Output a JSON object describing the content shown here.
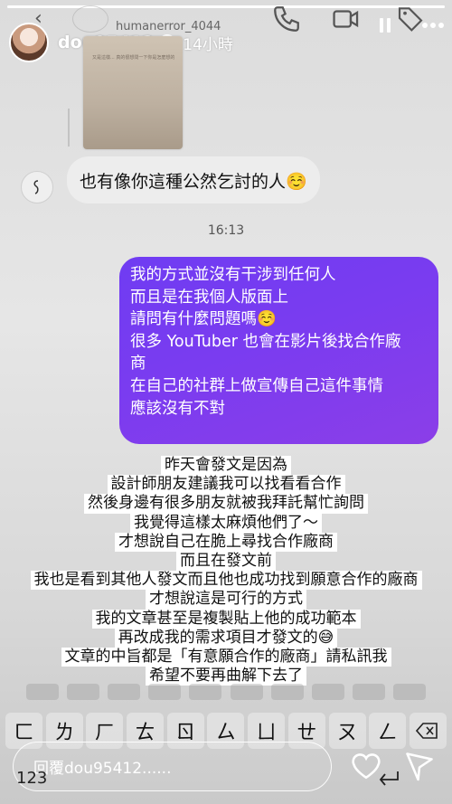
{
  "story": {
    "username": "dou95412",
    "time_ago": "14小時",
    "progress": 1.0
  },
  "background_chat": {
    "other_username": "humanerror_4044",
    "shared_image_text": "又是這樣... 真的很想問一下你是怎麼想的",
    "incoming_message": "也有像你這種公然乞討的人☺️",
    "timestamp": "16:13",
    "outgoing_lines": [
      "我的方式並沒有干涉到任何人",
      "而且是在我個人版面上",
      "請問有什麼問題嗎☺️",
      "很多 YouTuber 也會在影片後找合作廠",
      "商",
      "在自己的社群上做宣傳自己這件事情",
      "應該沒有不對"
    ]
  },
  "overlay_lines": [
    "昨天會發文是因為",
    "設計師朋友建議我可以找看看合作",
    "然後身邊有很多朋友就被我拜託幫忙詢問",
    "我覺得這樣太麻煩他們了～",
    "才想說自己在脆上尋找合作廠商",
    "而且在發文前",
    "我也是看到其他人發文而且他也成功找到願意合作的廠商",
    "才想說這是可行的方式",
    "我的文章甚至是複製貼上他的成功範本",
    "再改成我的需求項目才發文的😅",
    "文章的中旨都是「有意願合作的廠商」請私訊我",
    "希望不要再曲解下去了"
  ],
  "keyboard": {
    "row": [
      "ㄈ",
      "ㄌ",
      "ㄏ",
      "ㄊ",
      "ㄖ",
      "ㄙ",
      "ㄩ",
      "ㄝ",
      "ㄡ",
      "ㄥ"
    ],
    "numbers_key": "123"
  },
  "reply": {
    "placeholder": "回覆dou95412......"
  },
  "icons": {
    "verified": "verified-badge-icon",
    "pause": "pause-icon",
    "more": "more-icon",
    "heart": "heart-icon",
    "send": "send-icon",
    "backspace": "backspace-icon",
    "return": "return-icon"
  }
}
